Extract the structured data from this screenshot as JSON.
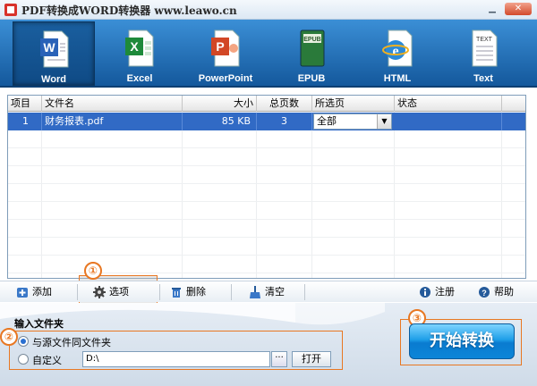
{
  "window": {
    "title": "PDF转换成WORD转换器 www.leawo.cn",
    "minimize_icon": "minimize-icon",
    "close_icon": "close-icon"
  },
  "formats": [
    {
      "label": "Word",
      "icon": "word-icon",
      "active": true
    },
    {
      "label": "Excel",
      "icon": "excel-icon",
      "active": false
    },
    {
      "label": "PowerPoint",
      "icon": "powerpoint-icon",
      "active": false
    },
    {
      "label": "EPUB",
      "icon": "epub-icon",
      "active": false
    },
    {
      "label": "HTML",
      "icon": "html-icon",
      "active": false
    },
    {
      "label": "Text",
      "icon": "text-icon",
      "active": false
    }
  ],
  "icon_text": {
    "epub": "EPUB",
    "text": "TEXT"
  },
  "table": {
    "columns": [
      "项目",
      "文件名",
      "大小",
      "总页数",
      "所选页",
      "状态"
    ],
    "rows": [
      {
        "index": "1",
        "filename": "财务报表.pdf",
        "size": "85  KB",
        "pages": "3",
        "selected_pages": "全部",
        "status": ""
      }
    ]
  },
  "actions": {
    "add": "添加",
    "options": "选项",
    "delete": "删除",
    "clear": "清空",
    "register": "注册",
    "help": "帮助"
  },
  "markers": {
    "one": "①",
    "two": "②",
    "three": "③"
  },
  "output": {
    "title": "输入文件夹",
    "same_folder_label": "与源文件同文件夹",
    "custom_label": "自定义",
    "path_value": "D:\\",
    "browse_label": "···",
    "open_label": "打开"
  },
  "start_label": "开始转换",
  "colors": {
    "accent": "#e87722",
    "toolbar": "#1e6fb8",
    "selection": "#316ac5"
  }
}
